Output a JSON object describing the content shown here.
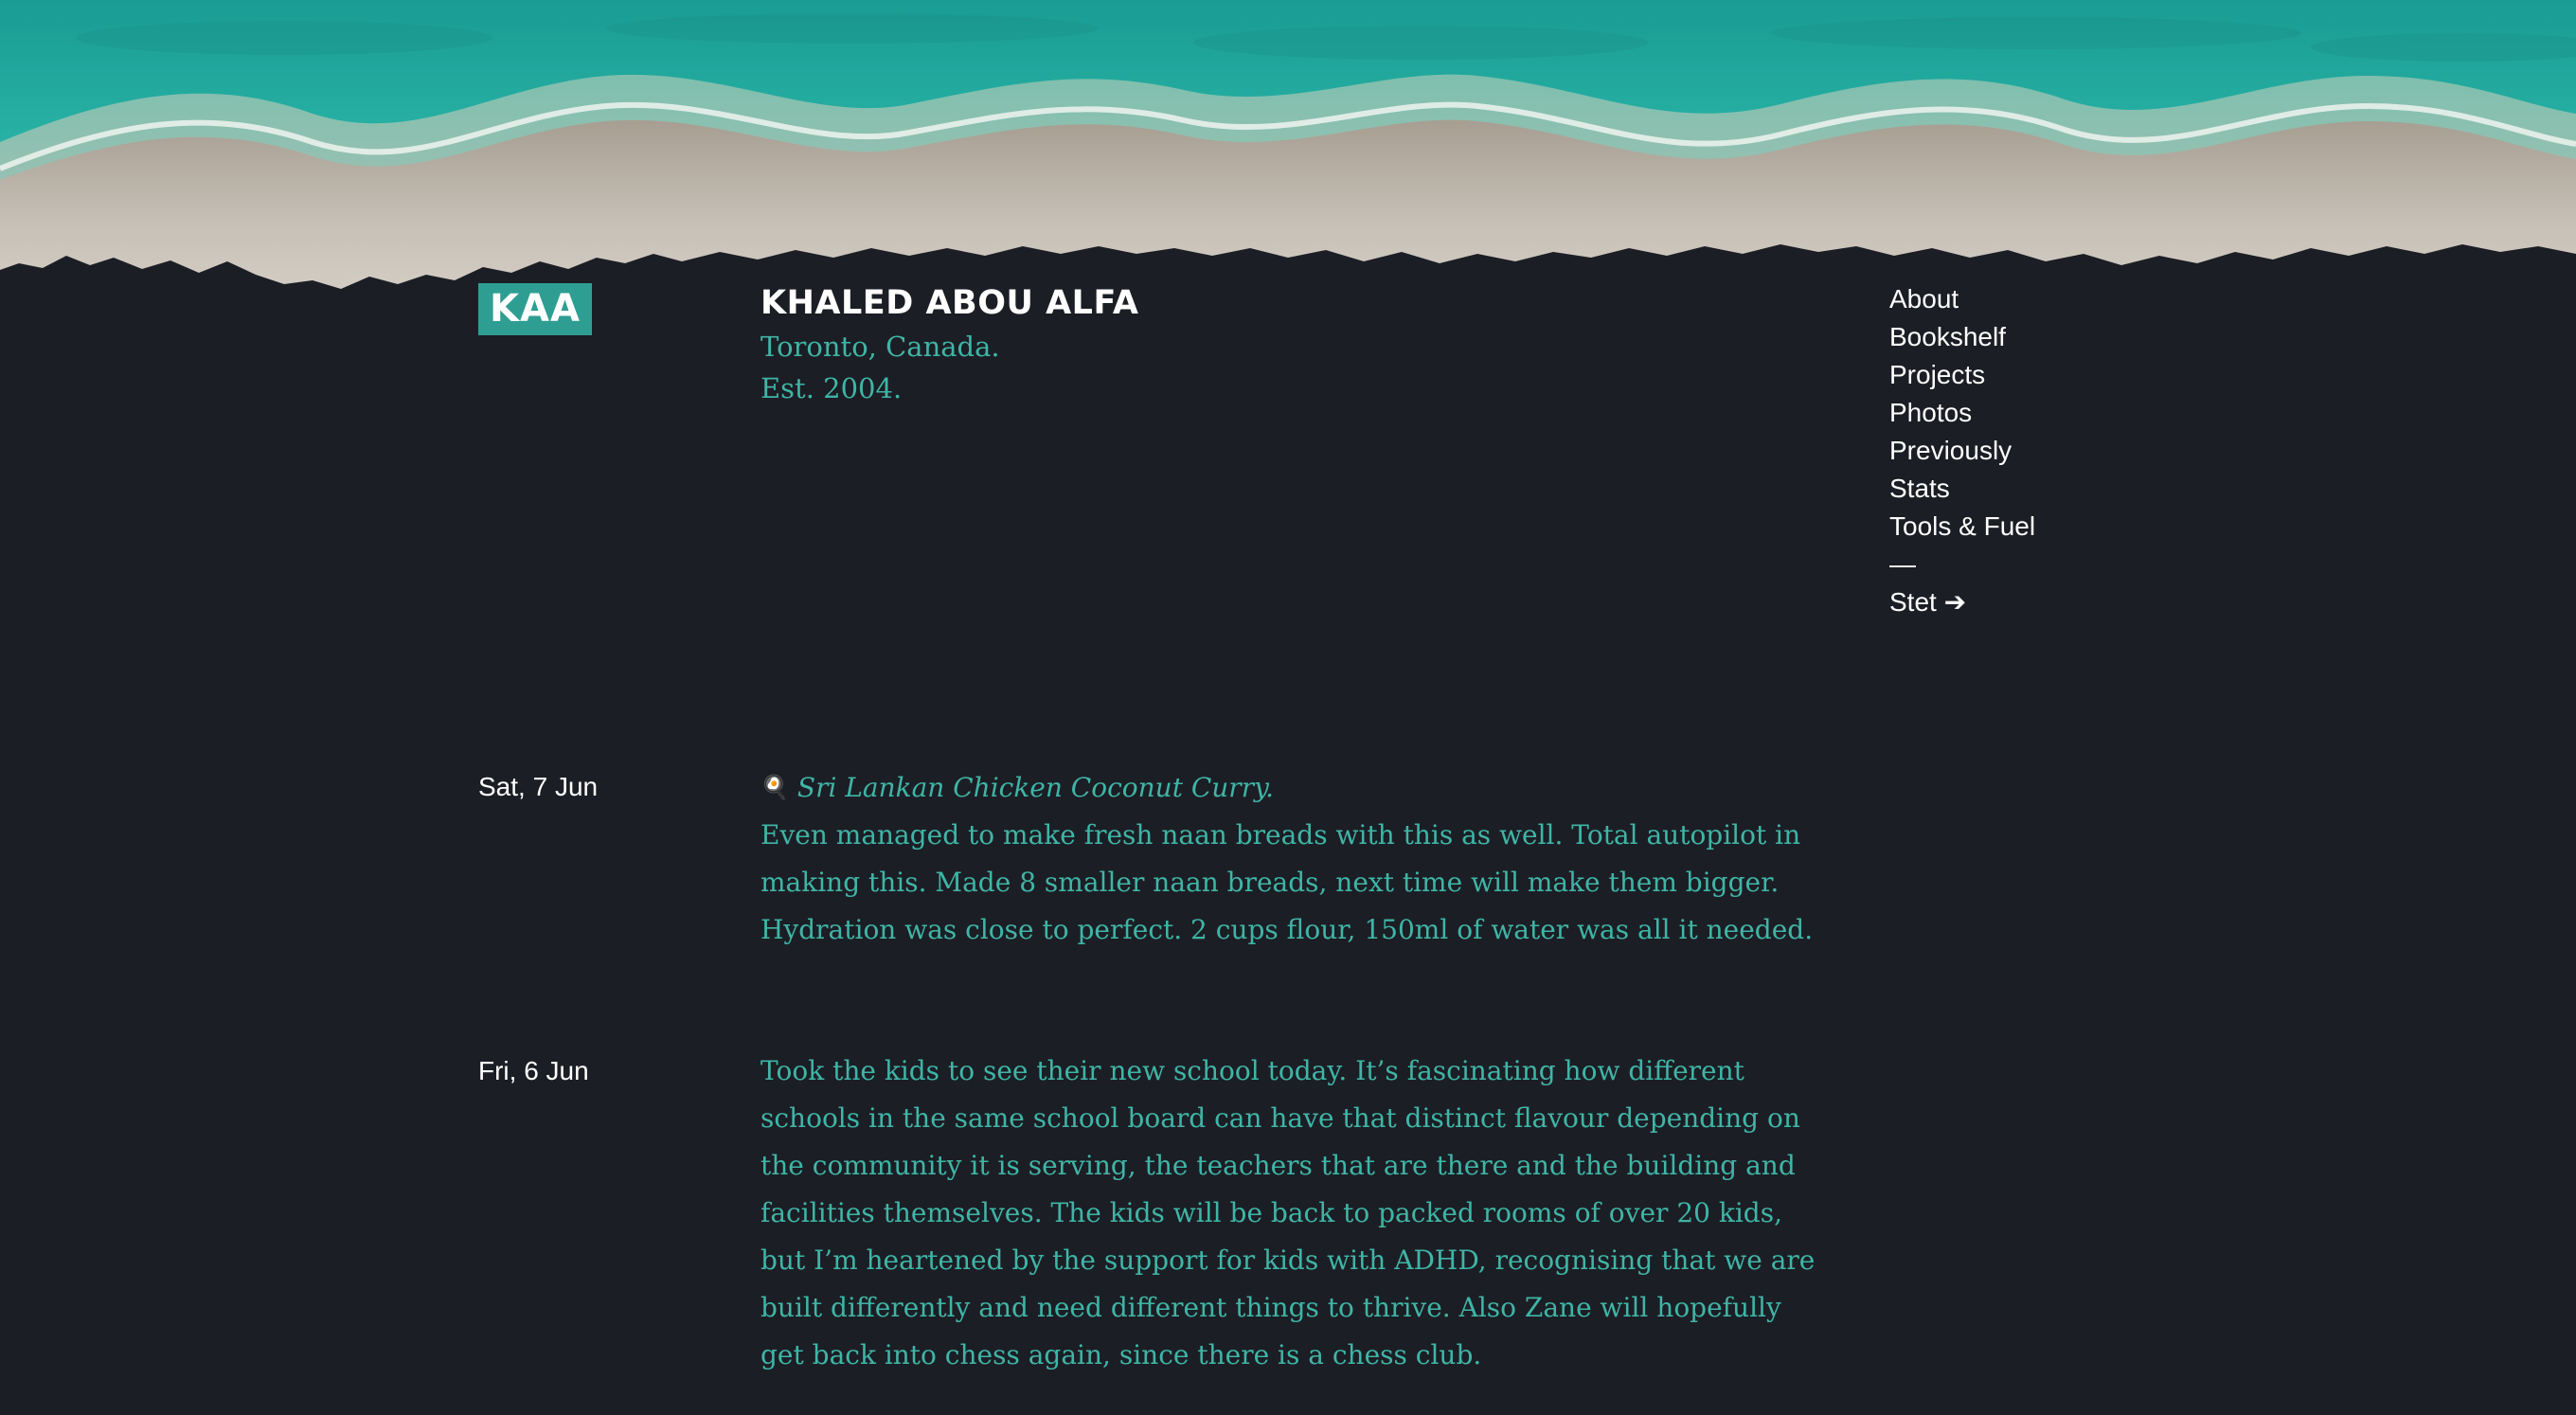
{
  "hero": {
    "description_icon": "beach-aerial-header"
  },
  "logo": {
    "text": "KAA"
  },
  "site": {
    "name": "KHALED ABOU ALFA",
    "location": "Toronto, Canada.",
    "established": "Est. 2004."
  },
  "nav": {
    "items": [
      {
        "label": "About"
      },
      {
        "label": "Bookshelf"
      },
      {
        "label": "Projects"
      },
      {
        "label": "Photos"
      },
      {
        "label": "Previously"
      },
      {
        "label": "Stats"
      },
      {
        "label": "Tools & Fuel"
      },
      {
        "label": "—"
      },
      {
        "label": "Stet ➔"
      }
    ]
  },
  "entries": [
    {
      "date": "Sat, 7 Jun",
      "icon": "🍳",
      "title": "Sri Lankan Chicken Coconut Curry.",
      "body": "Even managed to make fresh naan breads with this as well. Total autopilot in making this. Made 8 smaller naan breads, next time will make them bigger. Hydration was close to perfect. 2 cups flour, 150ml of water was all it needed."
    },
    {
      "date": "Fri, 6 Jun",
      "body": "Took the kids to see their new school today. It’s fascinating how different schools in the same school board can have that distinct flavour depending on the community it is serving, the teachers that are there and the building and facilities themselves. The kids will be back to packed rooms of over 20 kids, but I’m heartened by the support for kids with ADHD, recognising that we are built differently and need different things to thrive. Also Zane will hopefully get back into chess again, since there is a chess club."
    }
  ],
  "colors": {
    "background": "#1c1e25",
    "accent": "#2f9e92",
    "text_teal": "#3fb5a6",
    "text_white": "#ffffff"
  }
}
